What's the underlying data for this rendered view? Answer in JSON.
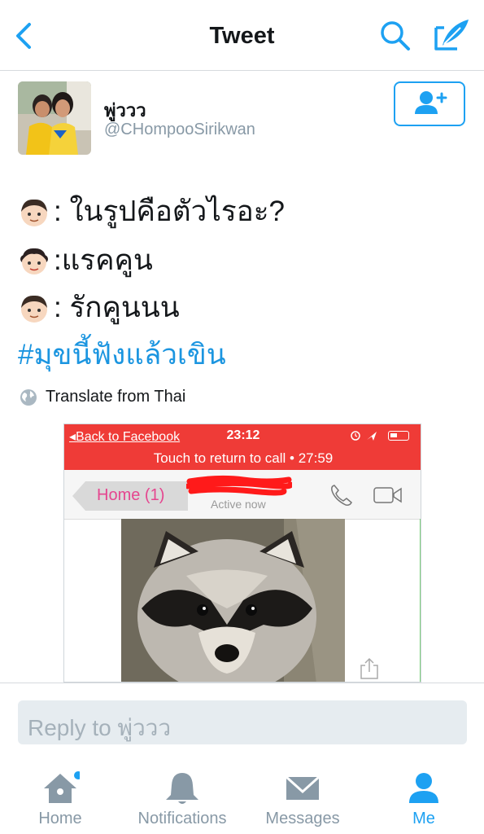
{
  "nav": {
    "title": "Tweet"
  },
  "author": {
    "name": "พู่ววว",
    "handle": "@CHompooSirikwan"
  },
  "tweet": {
    "lines": [
      {
        "emoji": "boy-face-emoji",
        "text": ": ในรูปคือตัวไรอะ?"
      },
      {
        "emoji": "girl-face-emoji",
        "text": ":แรคคูน"
      },
      {
        "emoji": "boy-face-emoji",
        "text": ": รักคูนนน"
      }
    ],
    "hashtag": "#มุขนี้ฟังแล้วเขิน",
    "translate": "Translate from Thai"
  },
  "media": {
    "back_link": "Back to Facebook",
    "time": "23:12",
    "call_banner": "Touch to return to call • 27:59",
    "home_label": "Home (1)",
    "status": "Active now"
  },
  "reply": {
    "placeholder": "Reply to พู่ววว"
  },
  "tabs": [
    {
      "label": "Home",
      "icon": "home-icon",
      "active": false,
      "notification_dot": true
    },
    {
      "label": "Notifications",
      "icon": "bell-icon",
      "active": false
    },
    {
      "label": "Messages",
      "icon": "envelope-icon",
      "active": false
    },
    {
      "label": "Me",
      "icon": "person-icon",
      "active": true
    }
  ],
  "colors": {
    "accent": "#1da1f2",
    "hashtag": "#1b95e0",
    "call_banner": "#ef3b37",
    "muted": "#8899a6"
  }
}
